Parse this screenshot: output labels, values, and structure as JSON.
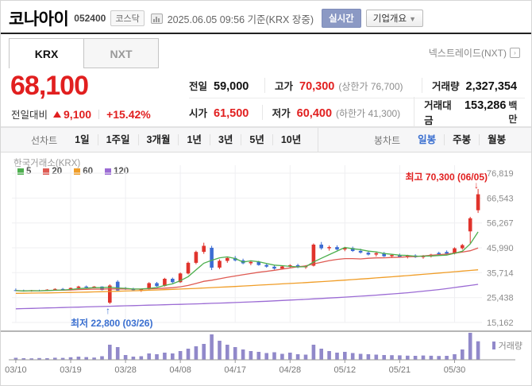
{
  "header": {
    "title": "코나아이",
    "code": "052400",
    "market_badge": "코스닥",
    "datetime": "2025.06.05 09:56 기준(KRX 장중)",
    "realtime_button": "실시간",
    "overview_button": "기업개요",
    "overview_arrow": "▼"
  },
  "tabs": {
    "krx": "KRX",
    "nxt": "NXT",
    "nxt_link": "넥스트레이드(NXT)"
  },
  "price": {
    "current": "68,100",
    "change_label": "전일대비",
    "change": "9,100",
    "change_pct": "+15.42%"
  },
  "summary": {
    "prev": {
      "label": "전일",
      "value": "59,000"
    },
    "high": {
      "label": "고가",
      "value": "70,300",
      "sub": "(상한가 76,700)"
    },
    "volume": {
      "label": "거래량",
      "value": "2,327,354"
    },
    "open": {
      "label": "시가",
      "value": "61,500"
    },
    "low": {
      "label": "저가",
      "value": "60,400",
      "sub": "(하한가 41,300)"
    },
    "amount": {
      "label": "거래대금",
      "value": "153,286",
      "unit": "백만"
    }
  },
  "toolbar": {
    "line_label": "선차트",
    "periods": [
      "1일",
      "1주일",
      "3개월",
      "1년",
      "3년",
      "5년",
      "10년"
    ],
    "candle_label": "봉차트",
    "candle_modes": [
      "일봉",
      "주봉",
      "월봉"
    ],
    "selected_mode": "일봉"
  },
  "chart_data": {
    "type": "candlestick",
    "exchange_label": "한국거래소(KRX)",
    "ma_legend": [
      {
        "key": "ma5",
        "label": "5"
      },
      {
        "key": "ma20",
        "label": "20"
      },
      {
        "key": "ma60",
        "label": "60"
      },
      {
        "key": "ma120",
        "label": "120"
      }
    ],
    "y_ticks": [
      76819,
      66543,
      56267,
      45990,
      35714,
      25438,
      15162
    ],
    "x_ticks": [
      {
        "i": 0,
        "label": "03/10"
      },
      {
        "i": 7,
        "label": "03/19"
      },
      {
        "i": 14,
        "label": "03/28"
      },
      {
        "i": 21,
        "label": "04/08"
      },
      {
        "i": 28,
        "label": "04/17"
      },
      {
        "i": 35,
        "label": "04/28"
      },
      {
        "i": 42,
        "label": "05/12"
      },
      {
        "i": 49,
        "label": "05/21"
      },
      {
        "i": 56,
        "label": "05/30"
      }
    ],
    "candles": [
      [
        28500,
        29200,
        28100,
        28300
      ],
      [
        28300,
        28700,
        27900,
        28100
      ],
      [
        28100,
        28600,
        27900,
        28400
      ],
      [
        28400,
        28700,
        28000,
        28200
      ],
      [
        28200,
        28900,
        28100,
        28700
      ],
      [
        28700,
        29300,
        28500,
        29000
      ],
      [
        29000,
        29400,
        28400,
        28600
      ],
      [
        28600,
        29600,
        28400,
        29400
      ],
      [
        29400,
        30300,
        29100,
        30000
      ],
      [
        30000,
        30400,
        29300,
        29600
      ],
      [
        29600,
        30200,
        29400,
        30000
      ],
      [
        30000,
        30100,
        28400,
        28600
      ],
      [
        23300,
        30900,
        22800,
        30400
      ],
      [
        32000,
        32600,
        28000,
        28400
      ],
      [
        29200,
        29800,
        28600,
        28900
      ],
      [
        28900,
        29500,
        28300,
        28500
      ],
      [
        28500,
        29000,
        27800,
        28900
      ],
      [
        28900,
        31800,
        28700,
        31400
      ],
      [
        31400,
        31900,
        29900,
        30200
      ],
      [
        30200,
        33600,
        30000,
        33200
      ],
      [
        33200,
        33700,
        31400,
        31800
      ],
      [
        31800,
        35800,
        31500,
        35400
      ],
      [
        35400,
        40300,
        35000,
        39800
      ],
      [
        39800,
        44800,
        39200,
        44300
      ],
      [
        44300,
        48100,
        43500,
        46800
      ],
      [
        46000,
        46800,
        36800,
        37800
      ],
      [
        37800,
        41200,
        37200,
        40600
      ],
      [
        40600,
        42400,
        39800,
        41800
      ],
      [
        41800,
        42600,
        40400,
        40800
      ],
      [
        40800,
        41500,
        39200,
        39600
      ],
      [
        39600,
        40800,
        38800,
        40200
      ],
      [
        40200,
        40600,
        38600,
        38900
      ],
      [
        38900,
        39600,
        37800,
        38200
      ],
      [
        38200,
        38900,
        37000,
        37400
      ],
      [
        37400,
        38600,
        37000,
        38300
      ],
      [
        38300,
        39200,
        37500,
        38800
      ],
      [
        38800,
        39400,
        37600,
        37900
      ],
      [
        37900,
        38800,
        37300,
        38500
      ],
      [
        38600,
        47800,
        38300,
        47300
      ],
      [
        47300,
        48400,
        45200,
        45800
      ],
      [
        45800,
        46900,
        44800,
        46300
      ],
      [
        46300,
        47000,
        44900,
        45300
      ],
      [
        45300,
        46400,
        44600,
        45900
      ],
      [
        45900,
        46500,
        44300,
        44700
      ],
      [
        44700,
        45600,
        43600,
        44000
      ],
      [
        44000,
        44800,
        42800,
        43200
      ],
      [
        43200,
        44200,
        42400,
        43800
      ],
      [
        43800,
        44300,
        42200,
        42500
      ],
      [
        42500,
        43400,
        41800,
        43000
      ],
      [
        43000,
        43600,
        41900,
        42200
      ],
      [
        42200,
        43100,
        41600,
        42800
      ],
      [
        42800,
        43300,
        41800,
        42100
      ],
      [
        42100,
        43000,
        41500,
        42700
      ],
      [
        42700,
        43500,
        42000,
        43200
      ],
      [
        43900,
        44400,
        42900,
        43300
      ],
      [
        44300,
        44900,
        43200,
        43600
      ],
      [
        43600,
        46200,
        43300,
        45800
      ],
      [
        45800,
        47600,
        45200,
        47100
      ],
      [
        52800,
        58800,
        47800,
        58200
      ],
      [
        61500,
        70300,
        60400,
        68100
      ]
    ],
    "volumes_k": [
      250,
      200,
      180,
      220,
      200,
      260,
      240,
      320,
      400,
      340,
      280,
      450,
      1900,
      1600,
      600,
      400,
      450,
      800,
      700,
      900,
      800,
      1100,
      1400,
      1700,
      2000,
      3200,
      2400,
      1900,
      1600,
      1300,
      1100,
      1000,
      850,
      950,
      750,
      900,
      700,
      650,
      1900,
      1400,
      1100,
      900,
      1000,
      850,
      750,
      700,
      650,
      600,
      580,
      560,
      520,
      500,
      540,
      510,
      480,
      500,
      700,
      1300,
      3400,
      2327
    ],
    "ma60_points": [
      27200,
      27400,
      27700,
      28100,
      28600,
      29200,
      29900,
      30700,
      31500,
      32400,
      33400,
      34500,
      35700,
      36900
    ],
    "ma120_points": [
      20800,
      21200,
      21600,
      22000,
      22400,
      22800,
      23300,
      23900,
      24600,
      25400,
      26300,
      27400,
      28900,
      30900
    ],
    "annotations": {
      "high": {
        "text": "최고 70,300 (06/05)",
        "arrow": "↓"
      },
      "low": {
        "text": "최저 22,800 (03/26)",
        "arrow": "↑"
      }
    },
    "volume_legend": "거래량",
    "colors": {
      "up": "#e0332c",
      "down": "#3c6cd3",
      "ma5": "#4daf4e",
      "ma20": "#df5a52",
      "ma60": "#f09d27",
      "ma120": "#9b6bd4",
      "volume": "#9189ca",
      "grid": "#efeff2",
      "axis_text": "#8b8b8b"
    }
  }
}
